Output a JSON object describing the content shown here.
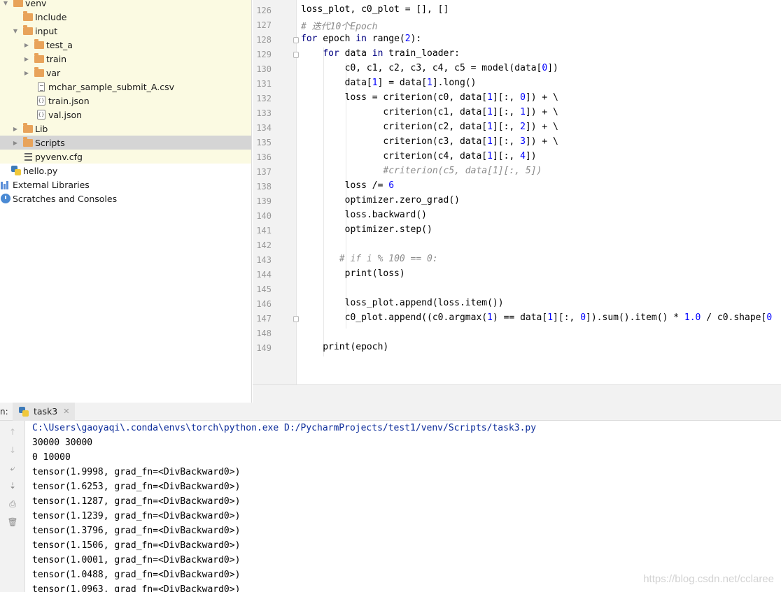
{
  "project_tree": [
    {
      "name": "venv",
      "type": "folder",
      "expanded": true
    },
    {
      "name": "Include",
      "type": "folder"
    },
    {
      "name": "input",
      "type": "folder",
      "expanded": true
    },
    {
      "name": "test_a",
      "type": "folder",
      "collapsed": true
    },
    {
      "name": "train",
      "type": "folder",
      "collapsed": true
    },
    {
      "name": "var",
      "type": "folder",
      "collapsed": true
    },
    {
      "name": "mchar_sample_submit_A.csv",
      "type": "csv-file"
    },
    {
      "name": "train.json",
      "type": "json-file"
    },
    {
      "name": "val.json",
      "type": "json-file"
    },
    {
      "name": "Lib",
      "type": "folder",
      "collapsed": true
    },
    {
      "name": "Scripts",
      "type": "folder",
      "collapsed": true,
      "selected": true
    },
    {
      "name": "pyvenv.cfg",
      "type": "cfg-file"
    },
    {
      "name": "hello.py",
      "type": "python-file"
    },
    {
      "name": "External Libraries",
      "type": "libraries"
    },
    {
      "name": "Scratches and Consoles",
      "type": "scratches"
    }
  ],
  "editor": {
    "lines": [
      {
        "n": "126",
        "text": "loss_plot, c0_plot = [], []"
      },
      {
        "n": "127",
        "text": "# 迭代10个Epoch"
      },
      {
        "n": "128",
        "text": "for epoch in range(2):"
      },
      {
        "n": "129",
        "text": "    for data in train_loader:"
      },
      {
        "n": "130",
        "text": "        c0, c1, c2, c3, c4, c5 = model(data[0])"
      },
      {
        "n": "131",
        "text": "        data[1] = data[1].long()"
      },
      {
        "n": "132",
        "text": "        loss = criterion(c0, data[1][:, 0]) + \\"
      },
      {
        "n": "133",
        "text": "               criterion(c1, data[1][:, 1]) + \\"
      },
      {
        "n": "134",
        "text": "               criterion(c2, data[1][:, 2]) + \\"
      },
      {
        "n": "135",
        "text": "               criterion(c3, data[1][:, 3]) + \\"
      },
      {
        "n": "136",
        "text": "               criterion(c4, data[1][:, 4])"
      },
      {
        "n": "137",
        "text": "               #criterion(c5, data[1][:, 5])"
      },
      {
        "n": "138",
        "text": "        loss /= 6"
      },
      {
        "n": "139",
        "text": "        optimizer.zero_grad()"
      },
      {
        "n": "140",
        "text": "        loss.backward()"
      },
      {
        "n": "141",
        "text": "        optimizer.step()"
      },
      {
        "n": "142",
        "text": ""
      },
      {
        "n": "143",
        "text": "       # if i % 100 == 0:"
      },
      {
        "n": "144",
        "text": "        print(loss)"
      },
      {
        "n": "145",
        "text": ""
      },
      {
        "n": "146",
        "text": "        loss_plot.append(loss.item())"
      },
      {
        "n": "147",
        "text": "        c0_plot.append((c0.argmax(1) == data[1][:, 0]).sum().item() * 1.0 / c0.shape[0"
      },
      {
        "n": "148",
        "text": ""
      },
      {
        "n": "149",
        "text": "    print(epoch)"
      }
    ]
  },
  "run_panel": {
    "label": "n:",
    "tab_label": "task3",
    "output": [
      "C:\\Users\\gaoyaqi\\.conda\\envs\\torch\\python.exe D:/PycharmProjects/test1/venv/Scripts/task3.py",
      "30000 30000",
      "0 10000",
      "tensor(1.9998, grad_fn=<DivBackward0>)",
      "tensor(1.6253, grad_fn=<DivBackward0>)",
      "tensor(1.1287, grad_fn=<DivBackward0>)",
      "tensor(1.1239, grad_fn=<DivBackward0>)",
      "tensor(1.3796, grad_fn=<DivBackward0>)",
      "tensor(1.1506, grad_fn=<DivBackward0>)",
      "tensor(1.0001, grad_fn=<DivBackward0>)",
      "tensor(1.0488, grad_fn=<DivBackward0>)",
      "tensor(1.0963, grad_fn=<DivBackward0>)"
    ]
  },
  "watermark": "https://blog.csdn.net/cclaree",
  "colors": {
    "keyword": "#000080",
    "number": "#0000ff",
    "comment": "#8c8c8c",
    "command": "#0b2b9a",
    "tree_highlight": "#fbfae2",
    "selected_row": "#d5d5d5",
    "folder": "#e8a35a"
  }
}
